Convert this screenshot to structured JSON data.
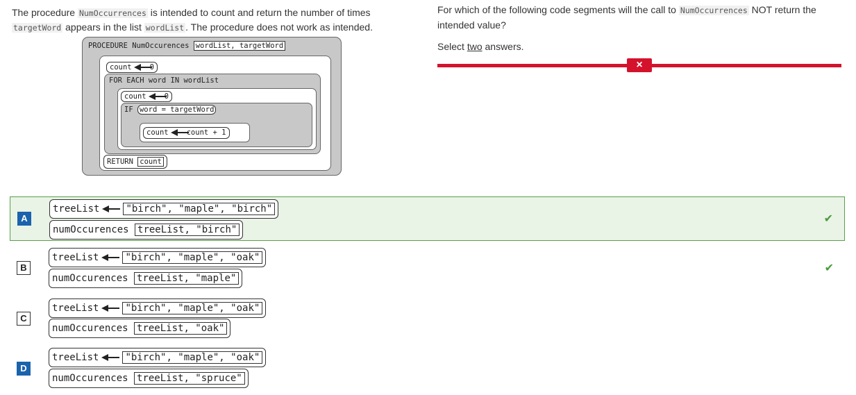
{
  "prompt": {
    "text1": "The procedure ",
    "code1": "NumOccurrences",
    "text2": " is intended to count and return the number of times ",
    "code2": "targetWord",
    "text3": " appears in the list ",
    "code3": "wordList",
    "text4": ". The procedure does not work as intended."
  },
  "procedure": {
    "header": "PROCEDURE NumOccurences",
    "params": "wordList, targetWord",
    "init_count": "count",
    "init_value": "0",
    "for_each": "FOR EACH word IN wordList",
    "inner_count": "count",
    "inner_value": "0",
    "if_keyword": "IF",
    "if_condition": "word = targetWord",
    "increment_left": "count",
    "increment_right": "count + 1",
    "return_keyword": "RETURN",
    "return_value": "count"
  },
  "question": {
    "text1": "For which of the following code segments will the call to ",
    "code": "NumOccurrences",
    "text2": " NOT return the intended value?",
    "select_prefix": "Select ",
    "select_word": "two",
    "select_suffix": " answers.",
    "feedback_icon": "×",
    "accent_color": "#d4122c"
  },
  "options": [
    {
      "letter": "A",
      "line1_var": "treeList",
      "line1_val": "\"birch\", \"maple\", \"birch\"",
      "line2_call": "numOccurences",
      "line2_args": "treeList, \"birch\"",
      "selected": true,
      "check": "✔"
    },
    {
      "letter": "B",
      "line1_var": "treeList",
      "line1_val": "\"birch\", \"maple\", \"oak\"",
      "line2_call": "numOccurences",
      "line2_args": "treeList, \"maple\"",
      "selected": false,
      "check": "✔"
    },
    {
      "letter": "C",
      "line1_var": "treeList",
      "line1_val": "\"birch\", \"maple\", \"oak\"",
      "line2_call": "numOccurences",
      "line2_args": "treeList, \"oak\"",
      "selected": false,
      "check": ""
    },
    {
      "letter": "D",
      "line1_var": "treeList",
      "line1_val": "\"birch\", \"maple\", \"oak\"",
      "line2_call": "numOccurences",
      "line2_args": "treeList, \"spruce\"",
      "selected": false,
      "check": ""
    }
  ]
}
